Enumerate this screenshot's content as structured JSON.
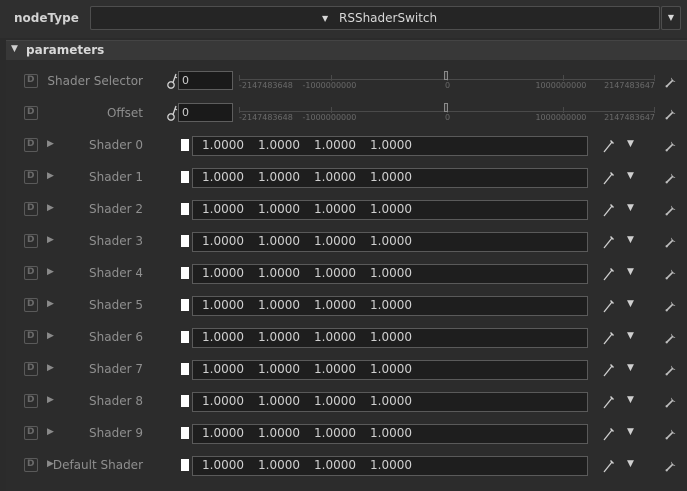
{
  "header": {
    "label": "nodeType",
    "selected": "RSShaderSwitch"
  },
  "section": {
    "title": "parameters"
  },
  "int_params": [
    {
      "label": "Shader Selector",
      "value": "0"
    },
    {
      "label": "Offset",
      "value": "0"
    }
  ],
  "slider_ticks": [
    "-2147483648",
    "-1000000000",
    "0",
    "1000000000",
    "2147483647"
  ],
  "shaders": [
    {
      "label": "Shader 0",
      "r": "1.0000",
      "g": "1.0000",
      "b": "1.0000",
      "a": "1.0000"
    },
    {
      "label": "Shader 1",
      "r": "1.0000",
      "g": "1.0000",
      "b": "1.0000",
      "a": "1.0000"
    },
    {
      "label": "Shader 2",
      "r": "1.0000",
      "g": "1.0000",
      "b": "1.0000",
      "a": "1.0000"
    },
    {
      "label": "Shader 3",
      "r": "1.0000",
      "g": "1.0000",
      "b": "1.0000",
      "a": "1.0000"
    },
    {
      "label": "Shader 4",
      "r": "1.0000",
      "g": "1.0000",
      "b": "1.0000",
      "a": "1.0000"
    },
    {
      "label": "Shader 5",
      "r": "1.0000",
      "g": "1.0000",
      "b": "1.0000",
      "a": "1.0000"
    },
    {
      "label": "Shader 6",
      "r": "1.0000",
      "g": "1.0000",
      "b": "1.0000",
      "a": "1.0000"
    },
    {
      "label": "Shader 7",
      "r": "1.0000",
      "g": "1.0000",
      "b": "1.0000",
      "a": "1.0000"
    },
    {
      "label": "Shader 8",
      "r": "1.0000",
      "g": "1.0000",
      "b": "1.0000",
      "a": "1.0000"
    },
    {
      "label": "Shader 9",
      "r": "1.0000",
      "g": "1.0000",
      "b": "1.0000",
      "a": "1.0000"
    },
    {
      "label": "Default Shader",
      "r": "1.0000",
      "g": "1.0000",
      "b": "1.0000",
      "a": "1.0000"
    }
  ],
  "icons": {
    "disable": "disable-d-icon",
    "key": "animation-key-icon",
    "wrench": "wrench-icon",
    "picker": "color-picker-icon",
    "expander": "expand-triangle-icon"
  }
}
